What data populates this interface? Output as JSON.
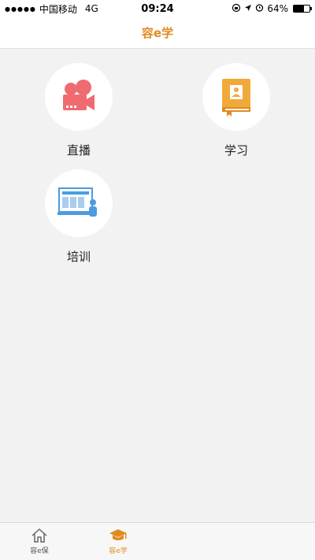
{
  "status_bar": {
    "signal": "●●●●●",
    "carrier": "中国移动",
    "network": "4G",
    "time": "09:24",
    "battery_text": "64%",
    "battery_level": 0.64
  },
  "nav": {
    "title": "容e学"
  },
  "grid": [
    {
      "label": "直播",
      "icon": "video-camera-icon"
    },
    {
      "label": "学习",
      "icon": "book-icon"
    },
    {
      "label": "培训",
      "icon": "training-screen-icon"
    }
  ],
  "tabs": [
    {
      "label": "容e保",
      "icon": "home-icon",
      "active": false
    },
    {
      "label": "容e学",
      "icon": "graduation-cap-icon",
      "active": true
    }
  ],
  "colors": {
    "accent": "#e08a1e",
    "video": "#ef6b6f",
    "book": "#f2a93b",
    "screen": "#4d9be0"
  }
}
